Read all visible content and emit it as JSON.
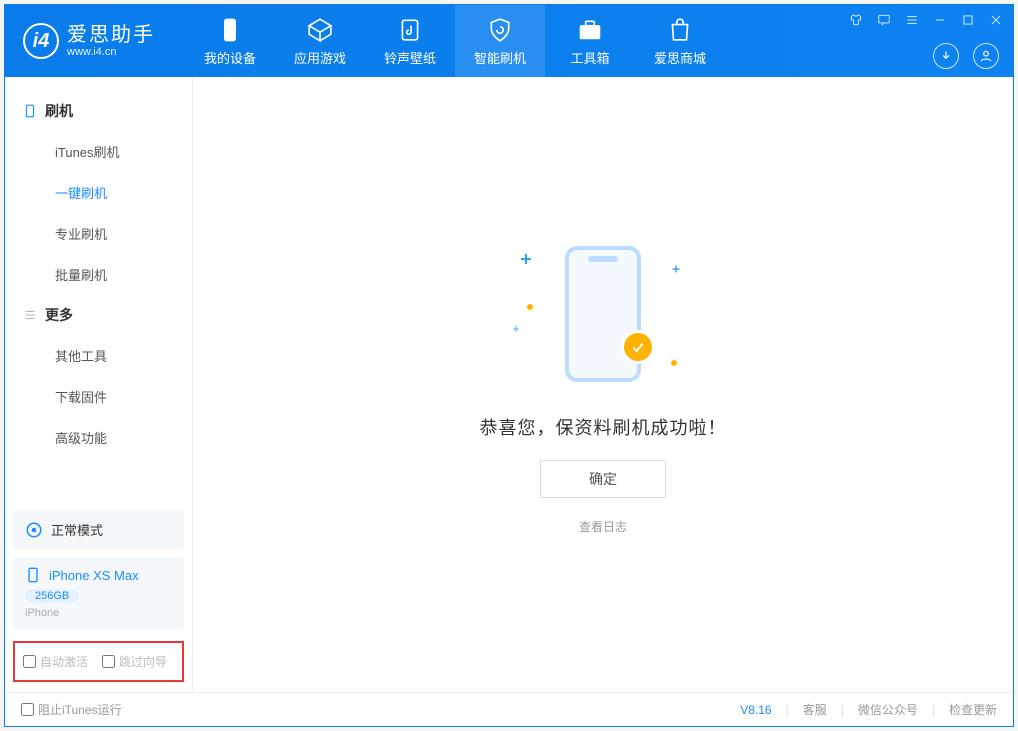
{
  "header": {
    "app_title": "爱思助手",
    "app_subtitle": "www.i4.cn",
    "nav": [
      "我的设备",
      "应用游戏",
      "铃声壁纸",
      "智能刷机",
      "工具箱",
      "爱思商城"
    ]
  },
  "sidebar": {
    "groups": [
      {
        "title": "刷机",
        "items": [
          "iTunes刷机",
          "一键刷机",
          "专业刷机",
          "批量刷机"
        ]
      },
      {
        "title": "更多",
        "items": [
          "其他工具",
          "下载固件",
          "高级功能"
        ]
      }
    ],
    "mode": "正常模式",
    "device": {
      "name": "iPhone XS Max",
      "storage": "256GB",
      "type": "iPhone"
    },
    "checks": [
      "自动激活",
      "跳过向导"
    ]
  },
  "main": {
    "success_text": "恭喜您，保资料刷机成功啦！",
    "ok_label": "确定",
    "view_log": "查看日志"
  },
  "statusbar": {
    "block_itunes": "阻止iTunes运行",
    "version": "V8.16",
    "links": [
      "客服",
      "微信公众号",
      "检查更新"
    ]
  }
}
